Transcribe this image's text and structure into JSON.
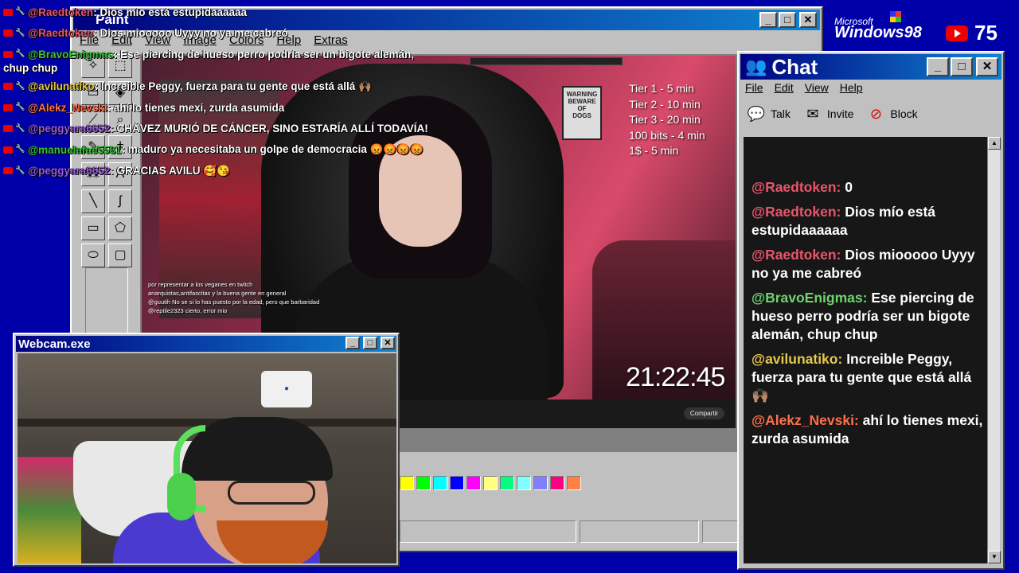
{
  "paint": {
    "title": "Paint",
    "menu": [
      "File",
      "Edit",
      "View",
      "Image",
      "Colors",
      "Help",
      "Extras"
    ],
    "palette": [
      "#ffff00",
      "#00ff00",
      "#00ffff",
      "#0000ff",
      "#ff00ff",
      "#ffff80",
      "#00ff80",
      "#80ffff",
      "#8080ff",
      "#ff0080",
      "#ff8040"
    ]
  },
  "stream": {
    "tiers": [
      "Tier 1 - 5 min",
      "Tier 2 - 10 min",
      "Tier 3 - 20 min",
      "100 bits - 4 min",
      "1$ - 5 min"
    ],
    "clock": "21:22:45",
    "share_label": "Compartir",
    "embedded_chat": [
      "por representar a los veganes en twitch",
      "anarquistas,antifascitas y la buena gente en general",
      "@guutih No se si lo has puesto por la edad, pero que barbaridad",
      "@reptile2323 cierto, error mio"
    ]
  },
  "webcam": {
    "title": "Webcam.exe"
  },
  "chat": {
    "title": "Chat",
    "menu": [
      "File",
      "Edit",
      "View",
      "Help"
    ],
    "toolbar": {
      "talk": "Talk",
      "invite": "Invite",
      "block": "Block"
    },
    "messages": [
      {
        "user": "@Raedtoken:",
        "text": "0",
        "color": "#e8566b"
      },
      {
        "user": "@Raedtoken:",
        "text": "Dios mío está estupidaaaaaa",
        "color": "#e8566b"
      },
      {
        "user": "@Raedtoken:",
        "text": "Dios miooooo Uyyy no ya me cabreó",
        "color": "#e8566b"
      },
      {
        "user": "@BravoEnigmas:",
        "text": "Ese piercing de hueso perro podría ser un bigote alemán, chup chup",
        "color": "#6fd36f"
      },
      {
        "user": "@avilunatiko:",
        "text": "Increible Peggy, fuerza para tu gente que está allá 🙌🏽",
        "color": "#e6c84a"
      },
      {
        "user": "@Alekz_Nevski:",
        "text": "ahí lo tienes mexi, zurda asumida",
        "color": "#ff6f4a"
      }
    ]
  },
  "overlay": {
    "messages": [
      {
        "user": "@Raedtoken",
        "text": ": Dios mío está estupidaaaaaa",
        "color": "#e8566b"
      },
      {
        "user": "@Raedtoken",
        "text": ": Dios miooooo Uyyy no ya me cabreó",
        "color": "#e8566b"
      },
      {
        "user": "@BravoEnigmas",
        "text": ": Ese piercing de hueso perro podría ser un bigote alemán,",
        "color": "#3ac23a"
      },
      {
        "user": "",
        "text": "chup chup",
        "color": "#ffffff"
      },
      {
        "user": "@avilunatiko",
        "text": ": Increible Peggy, fuerza para tu gente que está allá 🙌🏽",
        "color": "#e6c84a"
      },
      {
        "user": "@Alekz_Nevski",
        "text": ": ahí lo tienes mexi, zurda asumida",
        "color": "#ff6f4a"
      },
      {
        "user": "@peggyara6652",
        "text": ": CHÁVEZ MURIÓ DE CÁNCER, SINO ESTARÍA ALLÍ TODAVÍA!",
        "color": "#9a5adf"
      },
      {
        "user": "@manuelafae5581",
        "text": ": maduro ya necesitaba un golpe de democracia 😡😡😡😡",
        "color": "#3ac23a"
      },
      {
        "user": "@peggyara6652",
        "text": ": GRACIAS AVILU 🥰😘",
        "color": "#9a5adf"
      }
    ]
  },
  "brand": {
    "microsoft": "Microsoft",
    "windows": "Windows98",
    "yt_count": "75"
  }
}
